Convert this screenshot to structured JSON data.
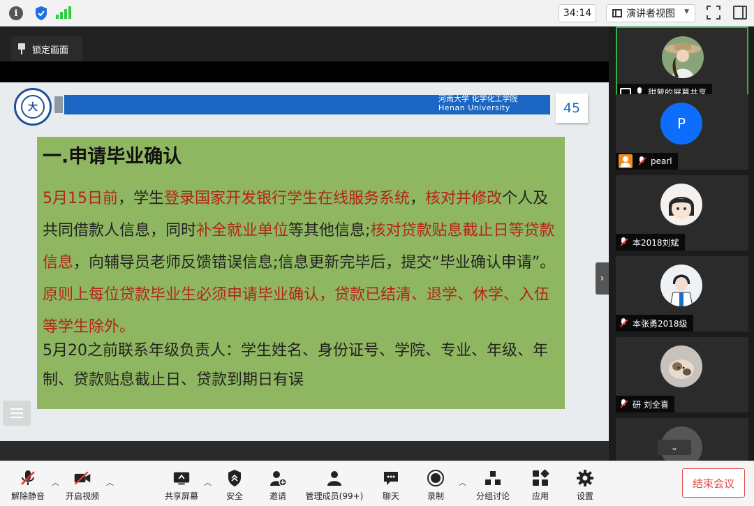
{
  "topbar": {
    "timer": "34:14",
    "view_label": "演讲者视图"
  },
  "main": {
    "lock_label": "锁定画面"
  },
  "slide": {
    "logo_text": "大",
    "univ_cn": "河南大学   化学化工学院",
    "univ_en": "Henan   University",
    "page_number": "45",
    "title": "一.申请毕业确认",
    "p1": [
      {
        "t": "5月15日前",
        "red": true
      },
      {
        "t": "，学生",
        "red": false
      },
      {
        "t": "登录国家开发银行学生在线服务系统",
        "red": true
      },
      {
        "t": "，",
        "red": false
      },
      {
        "t": "核对并修改",
        "red": true
      },
      {
        "t": "个人及共同借款人信息，同时",
        "red": false
      },
      {
        "t": "补全就业单位",
        "red": true
      },
      {
        "t": "等其他信息;",
        "red": false
      },
      {
        "t": "核对贷款贴息截止日等贷款信息",
        "red": true
      },
      {
        "t": "，向辅导员老师反馈错误信息;信息更新完毕后，提交“毕业确认申请”。",
        "red": false
      },
      {
        "t": "原则上每位贷款毕业生必须申请毕业确认，贷款已结清、退学、休学、入伍等学生除外。",
        "red": true
      }
    ],
    "p2": "5月20之前联系年级负责人：学生姓名、身份证号、学院、专业、年级、年制、贷款贴息截止日、贷款到期日有误"
  },
  "participants": [
    {
      "name": "甜萝的屏幕共享",
      "active": true,
      "kind": "photo-hat"
    },
    {
      "name": "pearl",
      "active": false,
      "kind": "letter",
      "letter": "P"
    },
    {
      "name": "本2018刘斌",
      "active": false,
      "kind": "anime-girl"
    },
    {
      "name": "本张勇2018级",
      "active": false,
      "kind": "anime-boy"
    },
    {
      "name": "研 刘全喜",
      "active": false,
      "kind": "cat"
    }
  ],
  "toolbar": {
    "mute": "解除静音",
    "video": "开启视频",
    "share": "共享屏幕",
    "security": "安全",
    "invite": "邀请",
    "members": "管理成员(99+)",
    "chat": "聊天",
    "record": "录制",
    "breakout": "分组讨论",
    "apps": "应用",
    "settings": "设置",
    "end": "结束会议"
  },
  "colors": {
    "accent_blue": "#1a66c2",
    "slide_green": "#8fb660",
    "text_red": "#b3241b",
    "active_border": "#2fb24c",
    "end_red": "#e14b4b"
  }
}
